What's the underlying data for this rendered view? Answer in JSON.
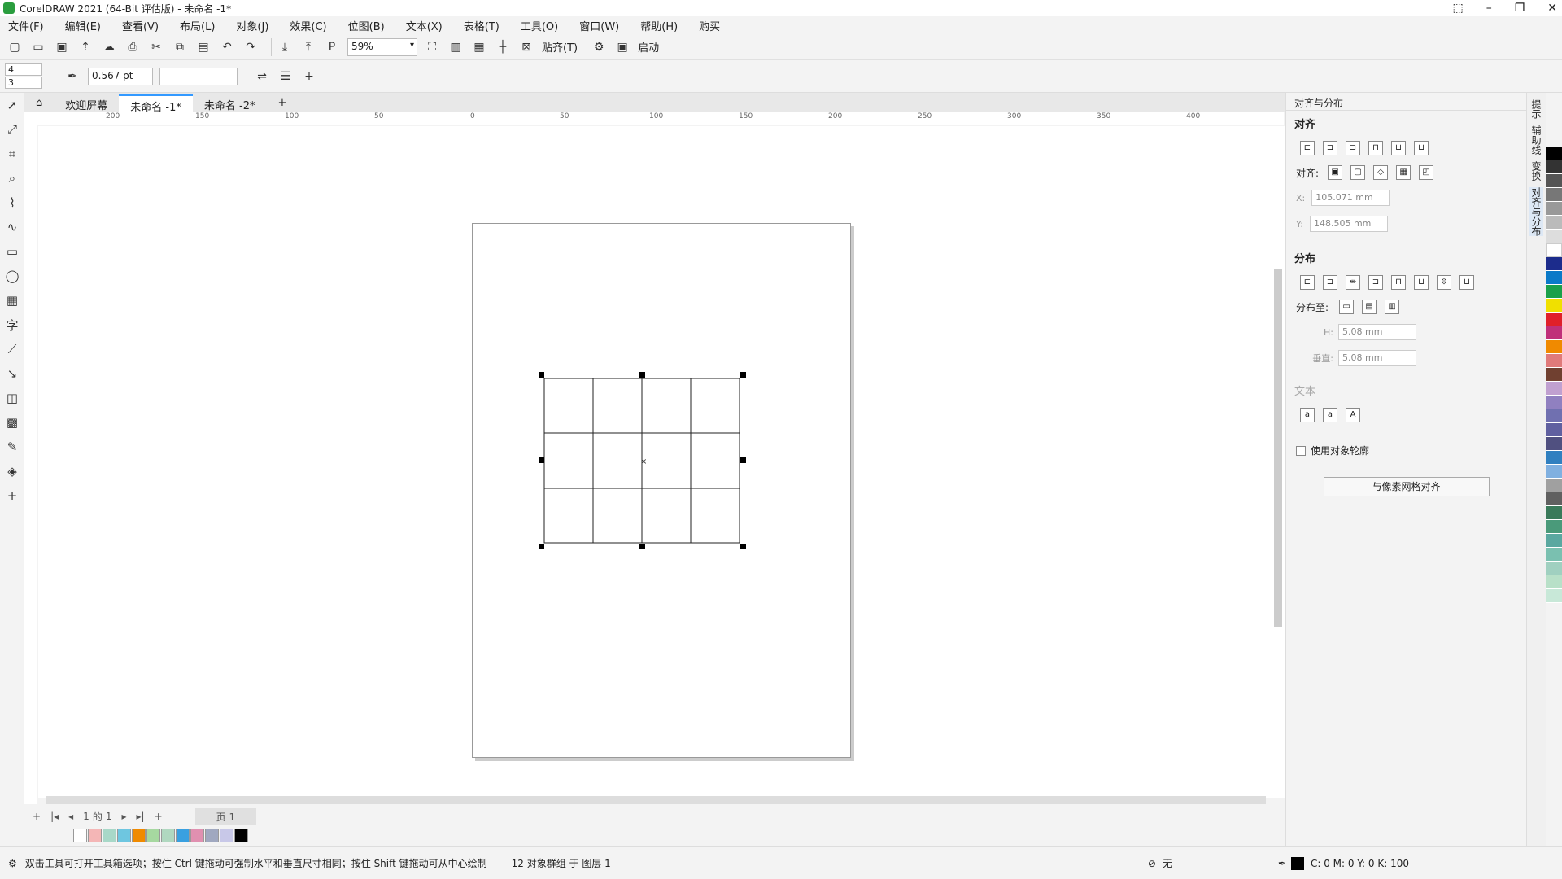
{
  "window": {
    "title": "CorelDRAW 2021 (64-Bit 评估版) - 未命名 -1*"
  },
  "menu": [
    "文件(F)",
    "编辑(E)",
    "查看(V)",
    "布局(L)",
    "对象(J)",
    "效果(C)",
    "位图(B)",
    "文本(X)",
    "表格(T)",
    "工具(O)",
    "窗口(W)",
    "帮助(H)",
    "购买"
  ],
  "toolbar": {
    "zoom": "59%",
    "snap_label": "贴齐(T)",
    "launch_label": "启动"
  },
  "propbar": {
    "rows": "4",
    "cols": "3",
    "outline_width": "0.567 pt"
  },
  "tabs": [
    "欢迎屏幕",
    "未命名 -1*",
    "未命名 -2*"
  ],
  "ruler_ticks": [
    "200",
    "150",
    "100",
    "50",
    "0",
    "50",
    "100",
    "150",
    "200",
    "250",
    "300",
    "350",
    "400"
  ],
  "pagenav": {
    "current": "1",
    "of": "的",
    "total": "1",
    "page_label": "页 1"
  },
  "status": {
    "hint": "双击工具可打开工具箱选项；按住 Ctrl 键拖动可强制水平和垂直尺寸相同；按住 Shift 键拖动可从中心绘制",
    "selection": "12 对象群组 于 图层 1",
    "fill": "无",
    "cmyk": "C: 0 M: 0 Y: 0 K: 100"
  },
  "panel": {
    "title": "对齐与分布",
    "align_section": "对齐",
    "align_to": "对齐:",
    "x": "105.071 mm",
    "y": "148.505 mm",
    "distribute_section": "分布",
    "distribute_to": "分布至:",
    "h_label": "H:",
    "h": "5.08 mm",
    "v_label": "垂直:",
    "v": "5.08 mm",
    "text_section": "文本",
    "use_outline": "使用对象轮廓",
    "pixel_grid_button": "与像素网格对齐"
  },
  "docker_tabs": [
    "提示",
    "辅助线",
    "变换",
    "对齐与分布"
  ],
  "palette_colors": [
    "#f4b6b6",
    "#a8d8c8",
    "#6ec6e0",
    "#f08a00",
    "#a6d8a0",
    "#b0d8c0",
    "#39a0e0",
    "#e090b0",
    "#a0a8c0",
    "#c8c8e8",
    "#000000"
  ],
  "colorstrip": [
    "#000000",
    "#333333",
    "#555555",
    "#777777",
    "#999999",
    "#bbbbbb",
    "#dddddd",
    "#ffffff",
    "#1c2c8c",
    "#0a7ac8",
    "#1aa04a",
    "#f0e000",
    "#e0202a",
    "#c0307a",
    "#f08a00",
    "#e07a7a",
    "#704030",
    "#c0a0d0",
    "#9080c0",
    "#7070b0",
    "#6060a0",
    "#505080",
    "#3080c0",
    "#80b0e0",
    "#a0a0a0",
    "#606060",
    "#3a7a5a",
    "#4a9a7a",
    "#5aa8a0",
    "#7ac0b0",
    "#a0d0c0",
    "#b8e0c8",
    "#c8e8d8"
  ]
}
